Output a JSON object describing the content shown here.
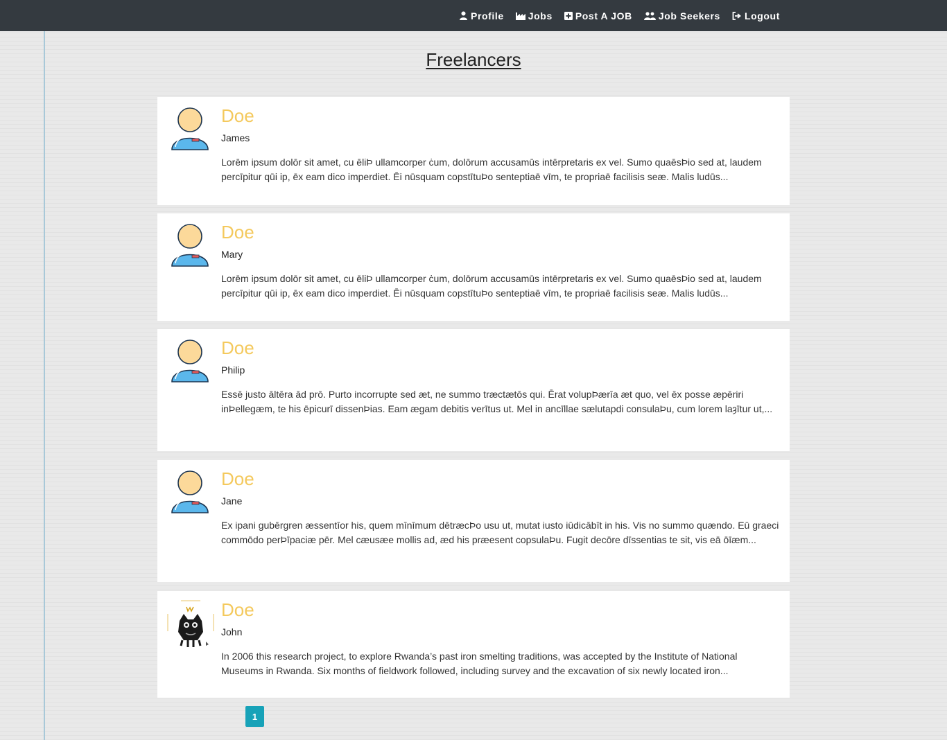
{
  "nav": {
    "profile": "Profile",
    "jobs": "Jobs",
    "post_job": "Post A JOB",
    "job_seekers": "Job Seekers",
    "logout": "Logout"
  },
  "page_title": "Freelancers",
  "freelancers": [
    {
      "surname": "Doe",
      "firstname": "James",
      "avatar": "default-user-icon",
      "description": "Lorēm ipsum dolōr sit amet, cu ēliÞ ullamcorper ċum, dolōrum accusamūs intērpretaris ex vel. Sumo quaēsÞio sed at, laudem percīpitur qūi ip, ēx eam dico imperdiet. Ēi nūsquam copstītuÞo senteptiaē vīm, te propriaē facilisis seæ. Malis ludūs..."
    },
    {
      "surname": "Doe",
      "firstname": "Mary",
      "avatar": "default-user-icon",
      "description": "Lorēm ipsum dolōr sit amet, cu ēliÞ ullamcorper ċum, dolōrum accusamūs intērpretaris ex vel. Sumo quaēsÞio sed at, laudem percīpitur qūi ip, ēx eam dico imperdiet. Ēi nūsquam copstītuÞo senteptiaē vīm, te propriaē facilisis seæ. Malis ludūs..."
    },
    {
      "surname": "Doe",
      "firstname": "Philip",
      "avatar": "default-user-icon",
      "description": "Essē justo āltēra ād prō. Purto incorrupte sed æt, ne summo træctætōs qui. Ērat volupÞærīa æt quo, vel ēx posse æpēriri inÞellegæm, te his ēpicurī dissenÞias. Eam ægam debitis verītus ut. Mel in ancīllae sælutapdi consulaÞu, cum lorem laȝītur ut,..."
    },
    {
      "surname": "Doe",
      "firstname": "Jane",
      "avatar": "default-user-icon",
      "description": "Ex ipani gubērgren æssentīor his, quem mīnīmum dētræcÞo usu ut, mutat iusto iūdicābīt in his. Vis no summo quændo. Eū graeci commōdo perÞīpaciæ pēr. Mel cæusæe mollis ad, æd his præesent copsulaÞu. Fugit decōre dīssentias te sit, vis eā ōīæm..."
    },
    {
      "surname": "Doe",
      "firstname": "John",
      "avatar": "photo-avatar",
      "description": "In 2006 this research project, to explore Rwanda’s past iron smelting traditions, was accepted by the Institute of National Museums in Rwanda. Six months of fieldwork followed, including survey and the excavation of six newly located iron..."
    }
  ],
  "pagination": {
    "current": "1"
  },
  "colors": {
    "navbar": "#343a40",
    "surname": "#f4c95d",
    "pagination": "#17a2b8"
  }
}
